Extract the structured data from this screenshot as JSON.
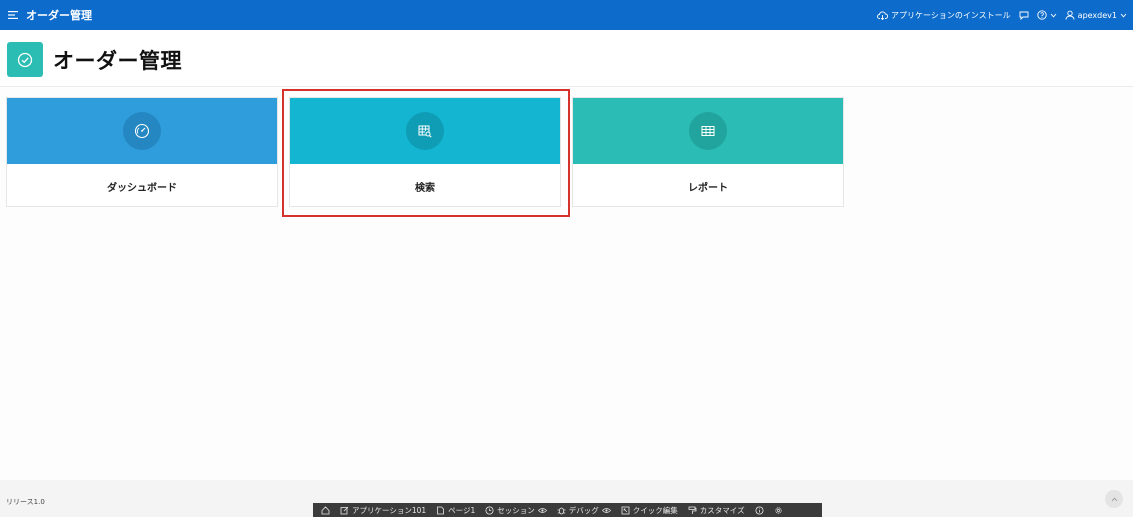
{
  "app": {
    "title": "オーダー管理"
  },
  "topbar": {
    "install_label": "アプリケーションのインストール",
    "user_label": "apexdev1"
  },
  "page": {
    "title": "オーダー管理"
  },
  "cards": [
    {
      "label": "ダッシュボード",
      "color": "#2f9ddb",
      "badge_color": "#2487c2",
      "icon": "dashboard-gauge-icon"
    },
    {
      "label": "検索",
      "color": "#13b5d1",
      "badge_color": "#0f9cb5",
      "icon": "table-search-icon"
    },
    {
      "label": "レポート",
      "color": "#2bbdb5",
      "badge_color": "#21a49d",
      "icon": "table-grid-icon"
    }
  ],
  "footer": {
    "release": "リリース1.0"
  },
  "devbar": {
    "application": "アプリケーション101",
    "page": "ページ1",
    "session": "セッション",
    "debug": "デバッグ",
    "quick_edit": "クイック編集",
    "customize": "カスタマイズ"
  },
  "colors": {
    "topbar": "#0c6bcb",
    "highlight": "#d6322c",
    "page_icon": "#2bbcb3"
  }
}
